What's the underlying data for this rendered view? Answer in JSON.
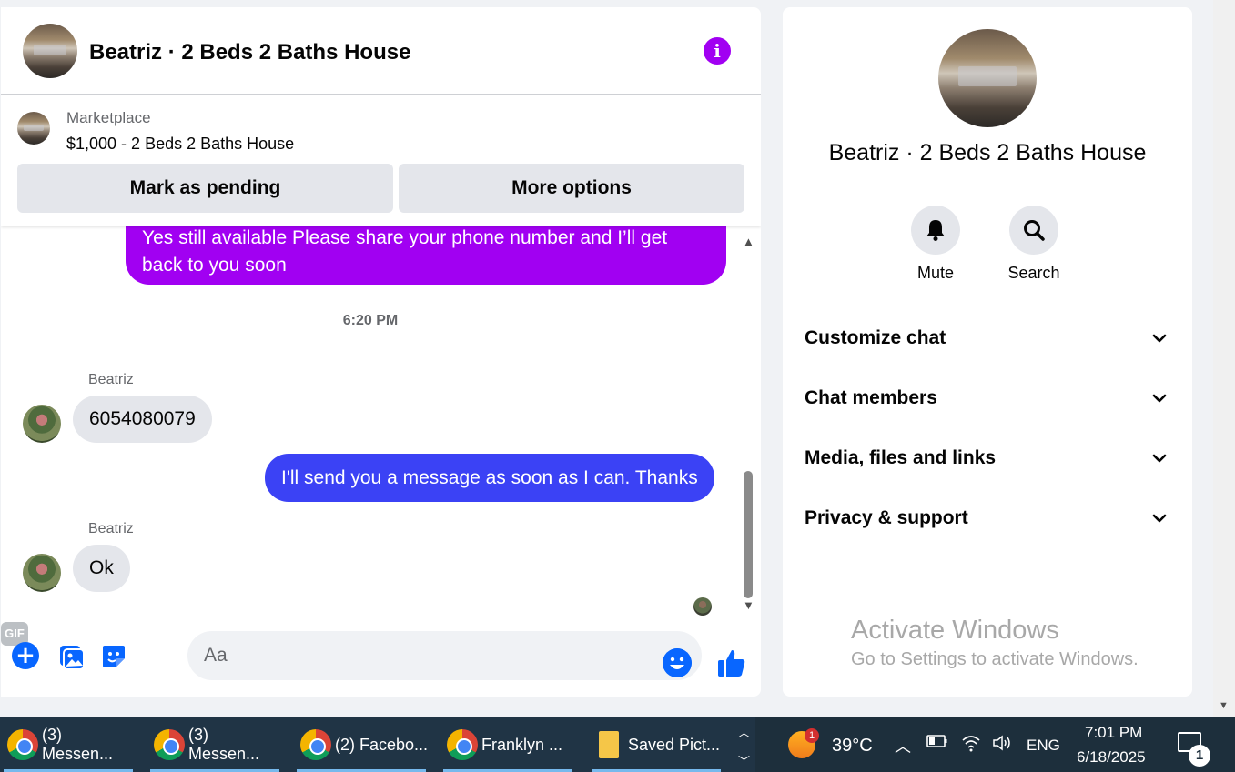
{
  "chat": {
    "title": "Beatriz · 2 Beds 2 Baths House",
    "listing": {
      "source": "Marketplace",
      "title": "$1,000 - 2 Beds 2 Baths House",
      "pending_label": "Mark as pending",
      "options_label": "More options"
    },
    "messages": [
      {
        "from": "me",
        "text": "Yes still available Please share your phone number and I’ll get back to you soon"
      },
      {
        "time": "6:20 PM"
      },
      {
        "from": "Beatriz",
        "sender": "Beatriz",
        "text": "6054080079"
      },
      {
        "from": "me",
        "text": "I'll send you a message as soon as I can. Thanks"
      },
      {
        "from": "Beatriz",
        "sender": "Beatriz",
        "text": "Ok"
      }
    ],
    "composer": {
      "placeholder": "Aa",
      "gif_label": "GIF"
    },
    "accent_purple": "#a100f2",
    "accent_blue": "#3b42f5"
  },
  "panel": {
    "title": "Beatriz · 2 Beds 2 Baths House",
    "mute_label": "Mute",
    "search_label": "Search",
    "sections": [
      "Customize chat",
      "Chat members",
      "Media, files and links",
      "Privacy & support"
    ]
  },
  "watermark": {
    "title": "Activate Windows",
    "subtitle": "Go to Settings to activate Windows."
  },
  "taskbar": {
    "tasks": [
      "(3) Messen...",
      "(3) Messen...",
      "(2) Facebo...",
      "Franklyn ...",
      "Saved Pict..."
    ],
    "weather_temp": "39°C",
    "weather_badge": "1",
    "language": "ENG",
    "time": "7:01 PM",
    "date": "6/18/2025",
    "notifications": "1"
  }
}
